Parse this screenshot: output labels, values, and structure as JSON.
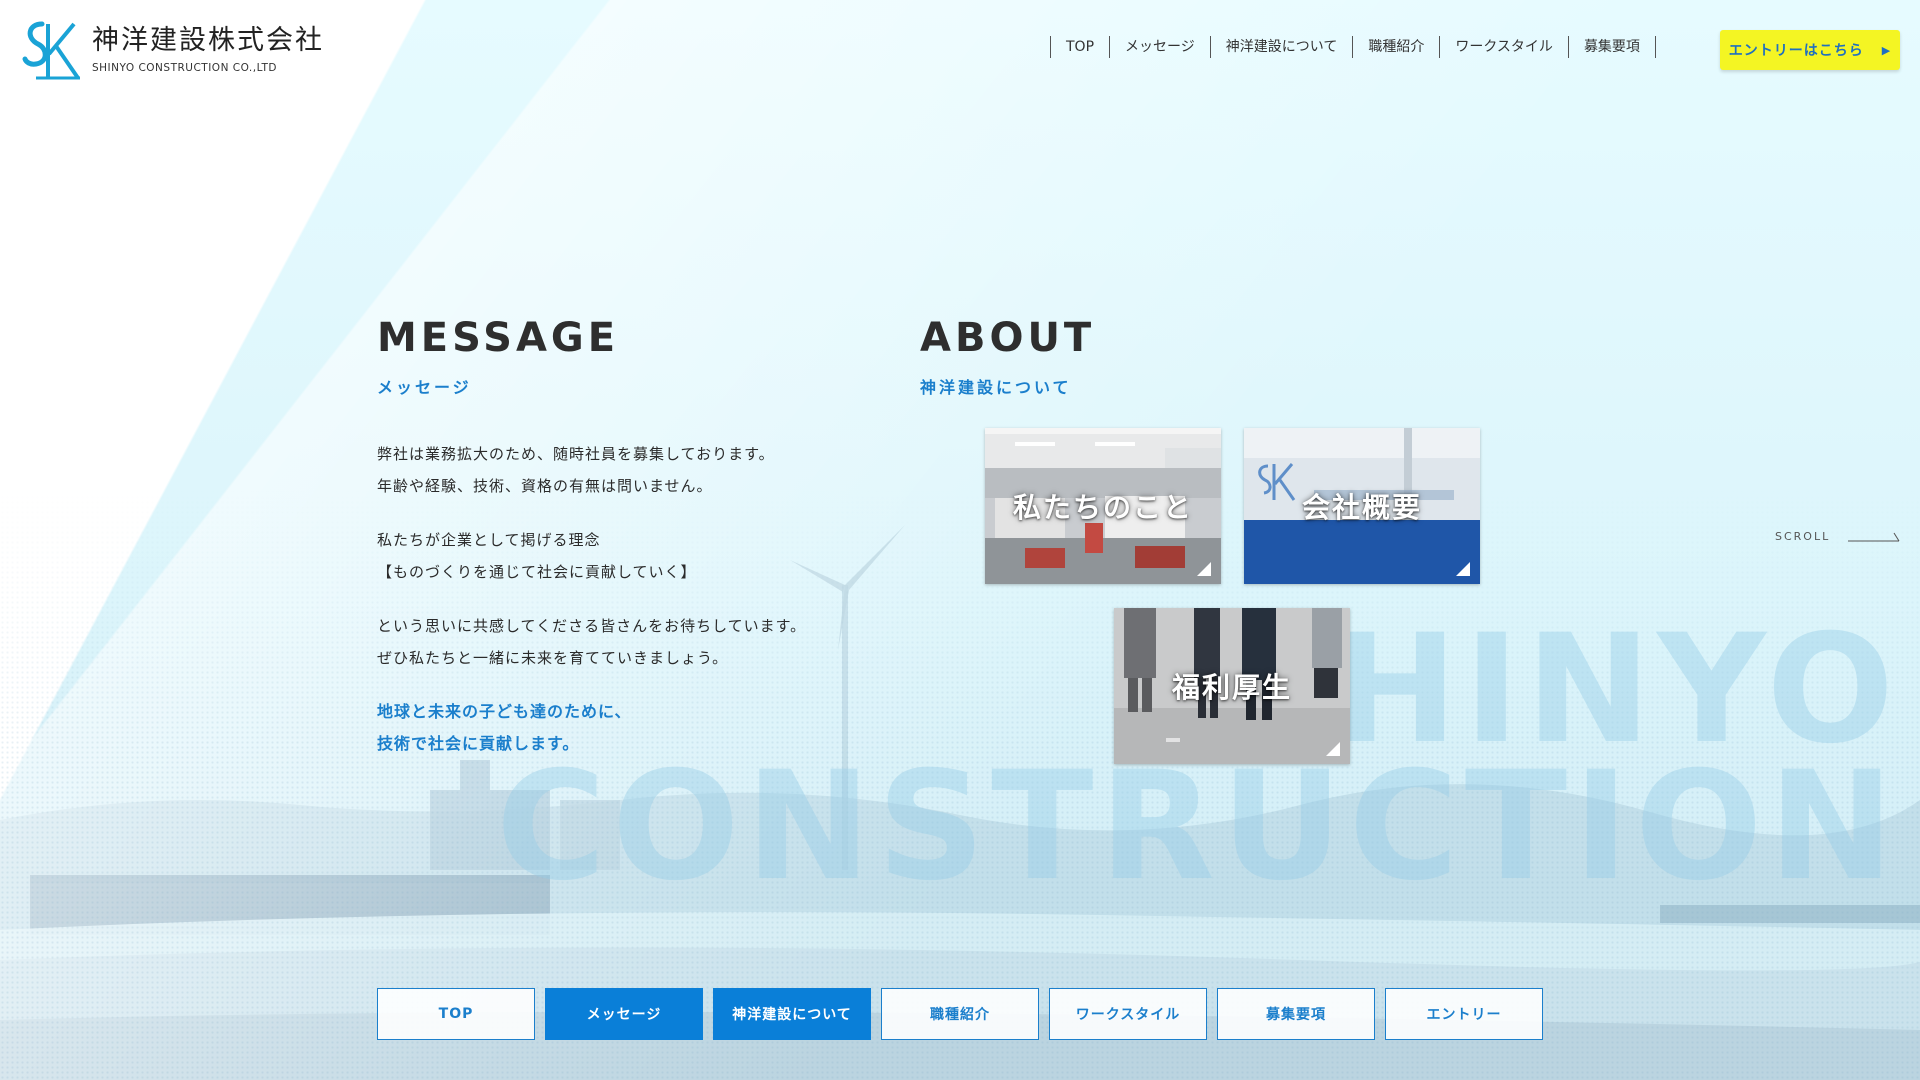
{
  "brand": {
    "name": "神洋建設株式会社",
    "sub": "SHINYO CONSTRUCTION CO.,LTD",
    "logo_icon": "sk-logo-icon",
    "accent_color": "#1b7fcc"
  },
  "gnav": {
    "items": [
      {
        "label": "TOP"
      },
      {
        "label": "メッセージ"
      },
      {
        "label": "神洋建設について"
      },
      {
        "label": "職種紹介"
      },
      {
        "label": "ワークスタイル"
      },
      {
        "label": "募集要項"
      }
    ],
    "entry_label": "エントリーはこちら",
    "entry_icon": "play-arrow-icon",
    "entry_color": "#f4f523"
  },
  "message": {
    "title": "MESSAGE",
    "subtitle": "メッセージ",
    "blocks": [
      [
        "弊社は業務拡大のため、随時社員を募集しております。",
        "年齢や経験、技術、資格の有無は問いません。"
      ],
      [
        "私たちが企業として掲げる理念",
        "【ものづくりを通じて社会に貢献していく】"
      ],
      [
        "という思いに共感してくださる皆さんをお待ちしています。",
        "ぜひ私たちと一緒に未来を育てていきましょう。"
      ]
    ],
    "accent_lines": [
      "地球と未来の子ども達のために、",
      "技術で社会に貢献します。"
    ]
  },
  "about": {
    "title": "ABOUT",
    "subtitle": "神洋建設について",
    "cards": [
      {
        "label": "私たちのこと",
        "photo": "office-interior-photo"
      },
      {
        "label": "会社概要",
        "photo": "company-sign-photo"
      },
      {
        "label": "福利厚生",
        "photo": "staff-standing-photo"
      }
    ]
  },
  "scroll": {
    "label": "SCROLL"
  },
  "background": {
    "watermark_lines": [
      "SHINYO",
      "CONSTRUCTION"
    ]
  },
  "bottom_nav": {
    "items": [
      {
        "label": "TOP",
        "active": false
      },
      {
        "label": "メッセージ",
        "active": true
      },
      {
        "label": "神洋建設について",
        "active": true
      },
      {
        "label": "職種紹介",
        "active": false
      },
      {
        "label": "ワークスタイル",
        "active": false
      },
      {
        "label": "募集要項",
        "active": false
      },
      {
        "label": "エントリー",
        "active": false
      }
    ],
    "active_color": "#0a7fd8"
  }
}
